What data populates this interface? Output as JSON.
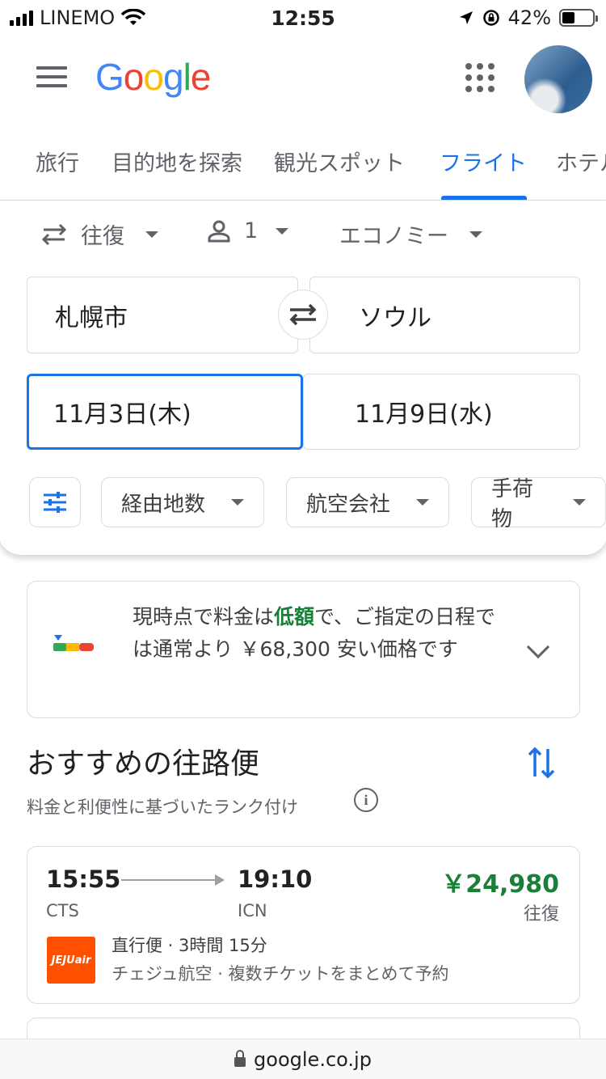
{
  "status_bar": {
    "carrier": "LINEMO",
    "time": "12:55",
    "battery": "42%",
    "battery_level": 0.42
  },
  "header": {
    "logo": "Google",
    "logo_colors": [
      "#4285F4",
      "#EA4335",
      "#FBBC05",
      "#4285F4",
      "#34A853",
      "#EA4335"
    ],
    "menu_icon": "hamburger-icon",
    "apps_icon": "apps-grid-icon"
  },
  "tabs": [
    {
      "label": "旅行",
      "active": false
    },
    {
      "label": "目的地を探索",
      "active": false
    },
    {
      "label": "観光スポット",
      "active": false
    },
    {
      "label": "フライト",
      "active": true
    },
    {
      "label": "ホテル",
      "active": false
    }
  ],
  "search": {
    "trip_type": "往復",
    "passengers": "1",
    "cabin_class": "エコノミー",
    "origin": "札幌市",
    "destination": "ソウル",
    "depart_date": "11月3日(木)",
    "return_date": "11月9日(水)",
    "filters": [
      {
        "label": "経由地数"
      },
      {
        "label": "航空会社"
      },
      {
        "label": "手荷物"
      }
    ]
  },
  "price_insight": {
    "prefix": "現時点で料金は",
    "highlight": "低額",
    "suffix": "で、ご指定の日程では通常より ￥68,300 安い価格です"
  },
  "section": {
    "title": "おすすめの往路便",
    "subtitle": "料金と利便性に基づいたランク付け"
  },
  "flights": [
    {
      "depart_time": "15:55",
      "arrive_time": "19:10",
      "depart_airport": "CTS",
      "arrive_airport": "ICN",
      "price": "￥24,980",
      "price_note": "往復",
      "airline_logo": "JEJUair",
      "duration_line": "直行便 · 3時間 15分",
      "airline_line": "チェジュ航空 · 複数チケットをまとめて予約"
    }
  ],
  "browser": {
    "url": "google.co.jp"
  },
  "colors": {
    "accent": "#1a73e8",
    "price_green": "#188038",
    "airline_brand": "#ff5000"
  }
}
